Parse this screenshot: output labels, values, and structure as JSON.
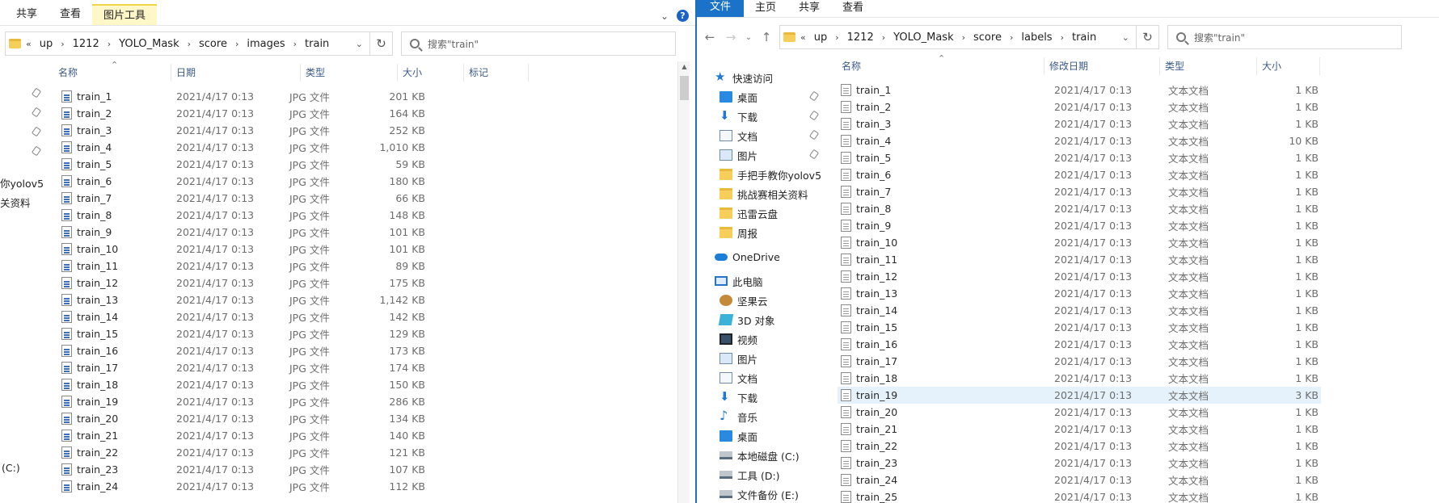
{
  "left": {
    "ribbon_tabs": [
      "共享",
      "查看",
      "图片工具"
    ],
    "path": [
      "up",
      "1212",
      "YOLO_Mask",
      "score",
      "images",
      "train"
    ],
    "path_prefix": "«",
    "search_placeholder": "搜索\"train\"",
    "columns": [
      "名称",
      "日期",
      "类型",
      "大小",
      "标记"
    ],
    "pinned_cut": [
      "你yolov5",
      "关资料"
    ],
    "bottom_cut": "(C:)",
    "files": [
      {
        "name": "train_1",
        "date": "2021/4/17 0:13",
        "type": "JPG 文件",
        "size": "201 KB"
      },
      {
        "name": "train_2",
        "date": "2021/4/17 0:13",
        "type": "JPG 文件",
        "size": "164 KB"
      },
      {
        "name": "train_3",
        "date": "2021/4/17 0:13",
        "type": "JPG 文件",
        "size": "252 KB"
      },
      {
        "name": "train_4",
        "date": "2021/4/17 0:13",
        "type": "JPG 文件",
        "size": "1,010 KB"
      },
      {
        "name": "train_5",
        "date": "2021/4/17 0:13",
        "type": "JPG 文件",
        "size": "59 KB"
      },
      {
        "name": "train_6",
        "date": "2021/4/17 0:13",
        "type": "JPG 文件",
        "size": "180 KB"
      },
      {
        "name": "train_7",
        "date": "2021/4/17 0:13",
        "type": "JPG 文件",
        "size": "66 KB"
      },
      {
        "name": "train_8",
        "date": "2021/4/17 0:13",
        "type": "JPG 文件",
        "size": "148 KB"
      },
      {
        "name": "train_9",
        "date": "2021/4/17 0:13",
        "type": "JPG 文件",
        "size": "101 KB"
      },
      {
        "name": "train_10",
        "date": "2021/4/17 0:13",
        "type": "JPG 文件",
        "size": "101 KB"
      },
      {
        "name": "train_11",
        "date": "2021/4/17 0:13",
        "type": "JPG 文件",
        "size": "89 KB"
      },
      {
        "name": "train_12",
        "date": "2021/4/17 0:13",
        "type": "JPG 文件",
        "size": "175 KB"
      },
      {
        "name": "train_13",
        "date": "2021/4/17 0:13",
        "type": "JPG 文件",
        "size": "1,142 KB"
      },
      {
        "name": "train_14",
        "date": "2021/4/17 0:13",
        "type": "JPG 文件",
        "size": "142 KB"
      },
      {
        "name": "train_15",
        "date": "2021/4/17 0:13",
        "type": "JPG 文件",
        "size": "129 KB"
      },
      {
        "name": "train_16",
        "date": "2021/4/17 0:13",
        "type": "JPG 文件",
        "size": "173 KB"
      },
      {
        "name": "train_17",
        "date": "2021/4/17 0:13",
        "type": "JPG 文件",
        "size": "174 KB"
      },
      {
        "name": "train_18",
        "date": "2021/4/17 0:13",
        "type": "JPG 文件",
        "size": "150 KB"
      },
      {
        "name": "train_19",
        "date": "2021/4/17 0:13",
        "type": "JPG 文件",
        "size": "286 KB"
      },
      {
        "name": "train_20",
        "date": "2021/4/17 0:13",
        "type": "JPG 文件",
        "size": "134 KB"
      },
      {
        "name": "train_21",
        "date": "2021/4/17 0:13",
        "type": "JPG 文件",
        "size": "140 KB"
      },
      {
        "name": "train_22",
        "date": "2021/4/17 0:13",
        "type": "JPG 文件",
        "size": "121 KB"
      },
      {
        "name": "train_23",
        "date": "2021/4/17 0:13",
        "type": "JPG 文件",
        "size": "107 KB"
      },
      {
        "name": "train_24",
        "date": "2021/4/17 0:13",
        "type": "JPG 文件",
        "size": "112 KB"
      }
    ]
  },
  "right": {
    "ribbon_tabs": [
      "文件",
      "主页",
      "共享",
      "查看"
    ],
    "path": [
      "up",
      "1212",
      "YOLO_Mask",
      "score",
      "labels",
      "train"
    ],
    "path_prefix": "«",
    "search_placeholder": "搜索\"train\"",
    "columns": [
      "名称",
      "修改日期",
      "类型",
      "大小"
    ],
    "nav": [
      {
        "label": "快速访问",
        "icon": "star-icon"
      },
      {
        "label": "桌面",
        "icon": "desktop-icon",
        "pinned": true
      },
      {
        "label": "下载",
        "icon": "download-icon",
        "pinned": true
      },
      {
        "label": "文档",
        "icon": "document-icon",
        "pinned": true
      },
      {
        "label": "图片",
        "icon": "picture-icon",
        "pinned": true
      },
      {
        "label": "手把手教你yolov5",
        "icon": "folder-icon"
      },
      {
        "label": "挑战赛相关资料",
        "icon": "folder-icon"
      },
      {
        "label": "迅雷云盘",
        "icon": "folder-icon"
      },
      {
        "label": "周报",
        "icon": "folder-icon"
      },
      {
        "label": "OneDrive",
        "icon": "cloud-icon"
      },
      {
        "label": "此电脑",
        "icon": "computer-icon"
      },
      {
        "label": "坚果云",
        "icon": "nut-icon"
      },
      {
        "label": "3D 对象",
        "icon": "3d-objects-icon"
      },
      {
        "label": "视频",
        "icon": "video-icon"
      },
      {
        "label": "图片",
        "icon": "picture-icon"
      },
      {
        "label": "文档",
        "icon": "document-icon"
      },
      {
        "label": "下载",
        "icon": "download-icon"
      },
      {
        "label": "音乐",
        "icon": "music-icon"
      },
      {
        "label": "桌面",
        "icon": "desktop-icon"
      },
      {
        "label": "本地磁盘 (C:)",
        "icon": "drive-icon"
      },
      {
        "label": "工具 (D:)",
        "icon": "drive-icon"
      },
      {
        "label": "文件备份 (E:)",
        "icon": "drive-icon"
      }
    ],
    "files": [
      {
        "name": "train_1",
        "date": "2021/4/17 0:13",
        "type": "文本文档",
        "size": "1 KB"
      },
      {
        "name": "train_2",
        "date": "2021/4/17 0:13",
        "type": "文本文档",
        "size": "1 KB"
      },
      {
        "name": "train_3",
        "date": "2021/4/17 0:13",
        "type": "文本文档",
        "size": "1 KB"
      },
      {
        "name": "train_4",
        "date": "2021/4/17 0:13",
        "type": "文本文档",
        "size": "10 KB"
      },
      {
        "name": "train_5",
        "date": "2021/4/17 0:13",
        "type": "文本文档",
        "size": "1 KB"
      },
      {
        "name": "train_6",
        "date": "2021/4/17 0:13",
        "type": "文本文档",
        "size": "1 KB"
      },
      {
        "name": "train_7",
        "date": "2021/4/17 0:13",
        "type": "文本文档",
        "size": "1 KB"
      },
      {
        "name": "train_8",
        "date": "2021/4/17 0:13",
        "type": "文本文档",
        "size": "1 KB"
      },
      {
        "name": "train_9",
        "date": "2021/4/17 0:13",
        "type": "文本文档",
        "size": "1 KB"
      },
      {
        "name": "train_10",
        "date": "2021/4/17 0:13",
        "type": "文本文档",
        "size": "1 KB"
      },
      {
        "name": "train_11",
        "date": "2021/4/17 0:13",
        "type": "文本文档",
        "size": "1 KB"
      },
      {
        "name": "train_12",
        "date": "2021/4/17 0:13",
        "type": "文本文档",
        "size": "1 KB"
      },
      {
        "name": "train_13",
        "date": "2021/4/17 0:13",
        "type": "文本文档",
        "size": "1 KB"
      },
      {
        "name": "train_14",
        "date": "2021/4/17 0:13",
        "type": "文本文档",
        "size": "1 KB"
      },
      {
        "name": "train_15",
        "date": "2021/4/17 0:13",
        "type": "文本文档",
        "size": "1 KB"
      },
      {
        "name": "train_16",
        "date": "2021/4/17 0:13",
        "type": "文本文档",
        "size": "1 KB"
      },
      {
        "name": "train_17",
        "date": "2021/4/17 0:13",
        "type": "文本文档",
        "size": "1 KB"
      },
      {
        "name": "train_18",
        "date": "2021/4/17 0:13",
        "type": "文本文档",
        "size": "1 KB"
      },
      {
        "name": "train_19",
        "date": "2021/4/17 0:13",
        "type": "文本文档",
        "size": "3 KB",
        "selected": true
      },
      {
        "name": "train_20",
        "date": "2021/4/17 0:13",
        "type": "文本文档",
        "size": "1 KB"
      },
      {
        "name": "train_21",
        "date": "2021/4/17 0:13",
        "type": "文本文档",
        "size": "1 KB"
      },
      {
        "name": "train_22",
        "date": "2021/4/17 0:13",
        "type": "文本文档",
        "size": "1 KB"
      },
      {
        "name": "train_23",
        "date": "2021/4/17 0:13",
        "type": "文本文档",
        "size": "1 KB"
      },
      {
        "name": "train_24",
        "date": "2021/4/17 0:13",
        "type": "文本文档",
        "size": "1 KB"
      },
      {
        "name": "train_25",
        "date": "2021/4/17 0:13",
        "type": "文本文档",
        "size": "1 KB"
      }
    ]
  },
  "colors": {
    "accent": "#1a73c9",
    "selection": "#e5f1fb",
    "ribbon_context": "#fff7c7"
  }
}
